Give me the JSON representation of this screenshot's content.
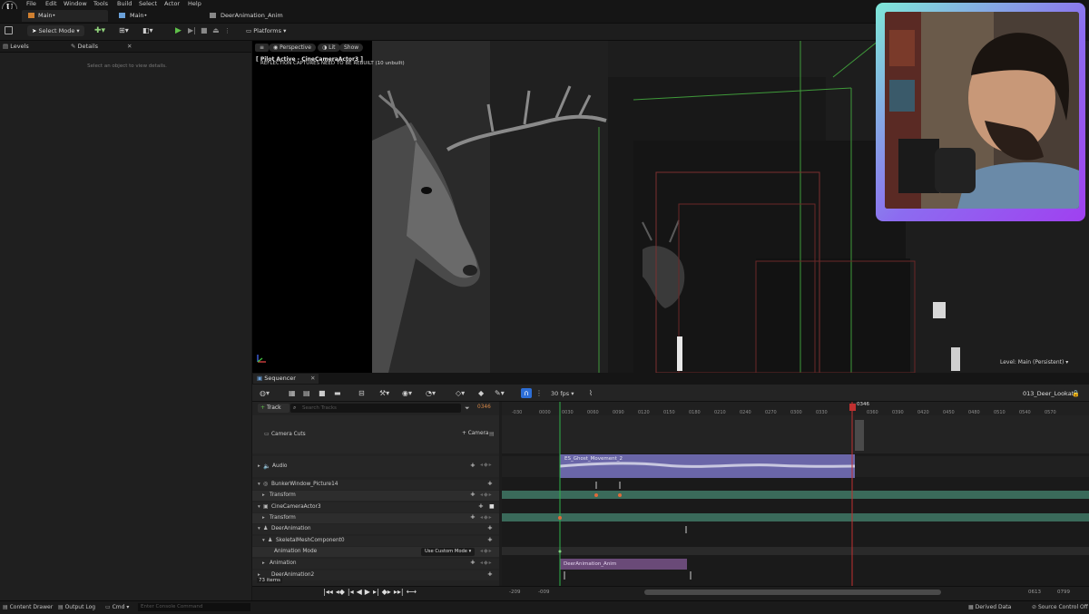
{
  "app": {
    "menu": [
      "File",
      "Edit",
      "Window",
      "Tools",
      "Build",
      "Select",
      "Actor",
      "Help"
    ],
    "tabs": [
      {
        "label": "Main•"
      },
      {
        "label": "Main•"
      },
      {
        "label": "DeerAnimation_Anim"
      }
    ]
  },
  "toolbar": {
    "mode_label": "Select Mode",
    "platforms_label": "Platforms"
  },
  "left_panel": {
    "tabs": [
      "Levels",
      "Details"
    ],
    "details_empty": "Select an object to view details."
  },
  "viewport": {
    "perspective_label": "Perspective",
    "lit_label": "Lit",
    "show_label": "Show",
    "pilot_label": "[ Pilot Active - CineCameraActor3 ]",
    "warning": "REFLECTION CAPTURES NEED TO BE REBUILT (10 unbuilt)",
    "level_label": "Level: Main (Persistent)"
  },
  "sequencer": {
    "tab_label": "Sequencer",
    "fps_label": "30 fps",
    "sequence_name": "013_Deer_Lookat",
    "track_button": "Track",
    "search_placeholder": "Search Tracks",
    "current_frame": "0346",
    "camera_button": "Camera",
    "items_count": "73 items",
    "range_start_a": "-209",
    "range_start_b": "-009",
    "range_end_a": "0613",
    "range_end_b": "0799",
    "ruler": [
      "-030",
      "0000",
      "0030",
      "0060",
      "0090",
      "0120",
      "0150",
      "0180",
      "0210",
      "0240",
      "0270",
      "0300",
      "0330",
      "0360",
      "0390",
      "0420",
      "0450",
      "0480",
      "0510",
      "0540",
      "0570"
    ],
    "tracks": [
      {
        "label": "Camera Cuts"
      },
      {
        "label": "Audio"
      },
      {
        "label": "BunkerWindow_Picture14"
      },
      {
        "label": "Transform"
      },
      {
        "label": "CineCameraActor3"
      },
      {
        "label": "Transform"
      },
      {
        "label": "DeerAnimation"
      },
      {
        "label": "SkeletalMeshComponent0"
      },
      {
        "label": "Animation Mode"
      },
      {
        "label": "Animation"
      },
      {
        "label": "DeerAnimation2"
      }
    ],
    "animation_mode_value": "Use Custom Mode",
    "audio_clip": "ES_Ghost_Movement_2",
    "anim_clip": "DeerAnimation_Anim"
  },
  "statusbar": {
    "content_drawer": "Content Drawer",
    "output_log": "Output Log",
    "cmd": "Cmd",
    "console_placeholder": "Enter Console Command",
    "derived_data": "Derived Data",
    "source_control": "Source Control Off"
  }
}
